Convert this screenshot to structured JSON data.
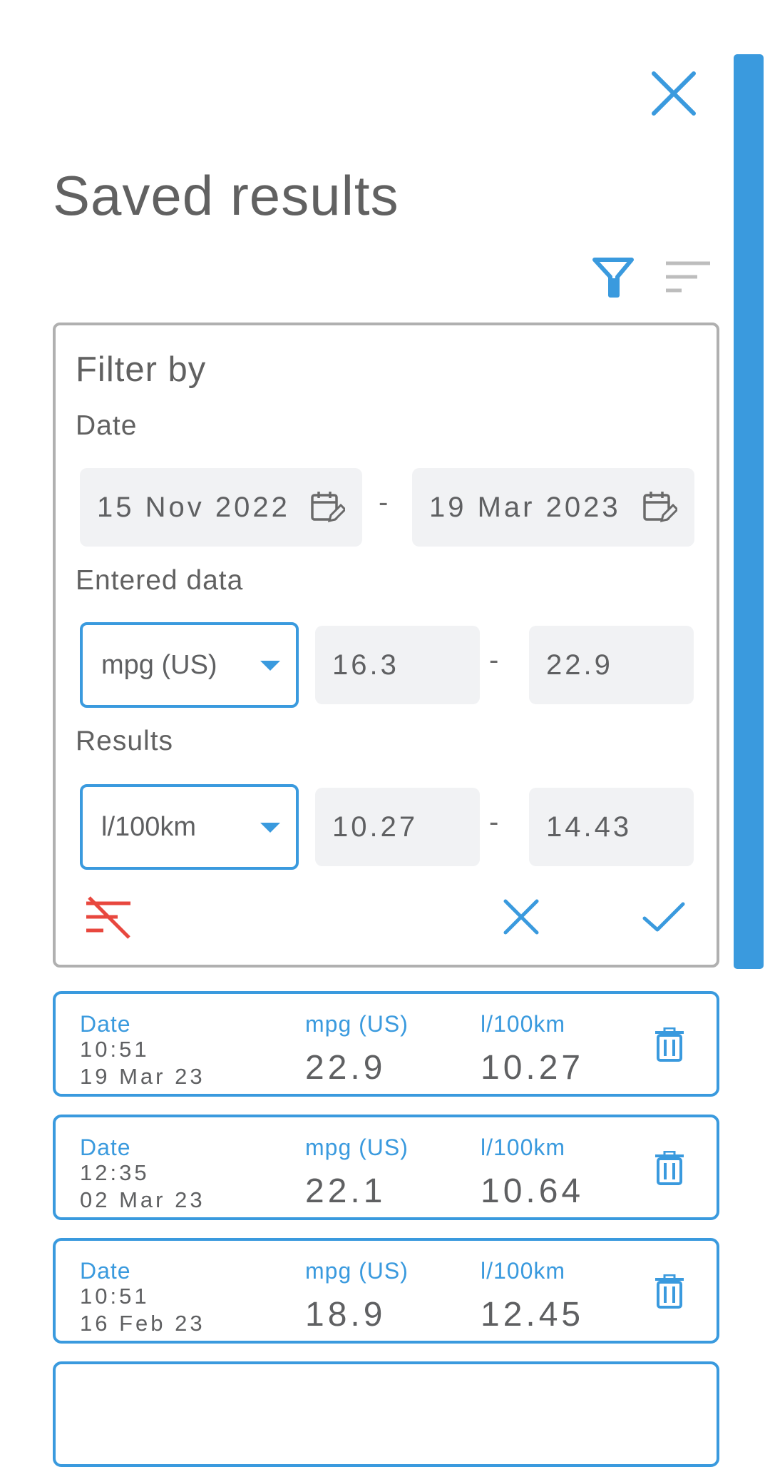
{
  "title": "Saved results",
  "icons": {
    "close": "close-icon",
    "filter": "filter-icon",
    "sort": "sort-icon",
    "calendar": "calendar-edit-icon",
    "clear_filter": "filter-off-icon",
    "cancel": "close-icon",
    "apply": "check-icon",
    "delete": "trash-icon"
  },
  "colors": {
    "accent": "#3a9ade",
    "danger": "#e8473e",
    "text": "#5f6062",
    "field_bg": "#f1f2f4",
    "panel_border": "#b0b0b0"
  },
  "filter": {
    "heading": "Filter by",
    "date": {
      "label": "Date",
      "from": "15 Nov 2022",
      "to": "19 Mar 2023",
      "separator": "-"
    },
    "entered": {
      "label": "Entered data",
      "unit": "mpg (US)",
      "min": "16.3",
      "max": "22.9",
      "separator": "-"
    },
    "results": {
      "label": "Results",
      "unit": "l/100km",
      "min": "10.27",
      "max": "14.43",
      "separator": "-"
    }
  },
  "results": [
    {
      "date_label": "Date",
      "time": "10:51",
      "date": "19 Mar 23",
      "entered_label": "mpg (US)",
      "entered_value": "22.9",
      "result_label": "l/100km",
      "result_value": "10.27"
    },
    {
      "date_label": "Date",
      "time": "12:35",
      "date": "02 Mar 23",
      "entered_label": "mpg (US)",
      "entered_value": "22.1",
      "result_label": "l/100km",
      "result_value": "10.64"
    },
    {
      "date_label": "Date",
      "time": "10:51",
      "date": "16 Feb 23",
      "entered_label": "mpg (US)",
      "entered_value": "18.9",
      "result_label": "l/100km",
      "result_value": "12.45"
    }
  ]
}
